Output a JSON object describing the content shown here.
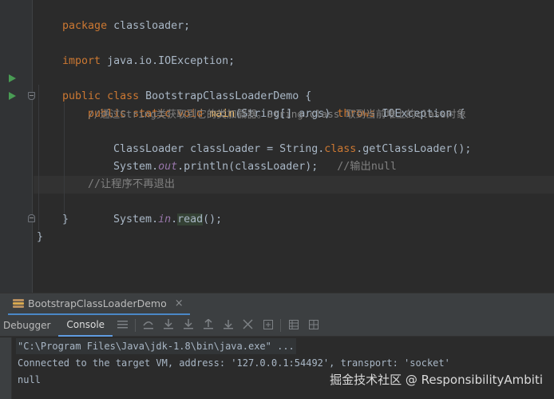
{
  "editor": {
    "lines": {
      "package_kw": "package",
      "package_name": " classloader;",
      "import_kw": "import",
      "import_name": " java.io.IOException;",
      "class_kw1": "public",
      "class_kw2": "class",
      "class_name": " BootstrapClassLoaderDemo {",
      "main_kw1": "public",
      "main_kw2": "static",
      "main_kw3": "void",
      "main_name": "main",
      "main_params": "(String[] args) ",
      "main_throws": "throws",
      "main_exc": " IOException {",
      "comment1": "//通过String类获取到它的类加载器。String.class 取到当前堆上的class对象",
      "cl_type": "ClassLoader classLoader = String.",
      "cl_class_kw": "class",
      "cl_rest": ".getClassLoader();",
      "print_pre": "System.",
      "print_out": "out",
      "print_rest": ".println(classLoader);",
      "comment2": "   //输出null",
      "comment3": "//让程序不再退出",
      "read_pre": "System.",
      "read_in": "in",
      "read_dot": ".",
      "read_name": "read",
      "read_rest": "();",
      "close_method": "}",
      "close_class": "}"
    }
  },
  "run_window": {
    "tab_label": "BootstrapClassLoaderDemo",
    "tab_close": "×",
    "subtabs": {
      "debugger": "Debugger",
      "console": "Console"
    },
    "toolbar_icons": [
      "menu-icon",
      "step-over-icon",
      "step-into-icon",
      "force-step-into-icon",
      "step-out-icon",
      "drop-frame-icon",
      "run-to-cursor-icon",
      "evaluate-icon",
      "table-icon",
      "settings-icon"
    ]
  },
  "console": {
    "command": "\"C:\\Program Files\\Java\\jdk-1.8\\bin\\java.exe\" ...",
    "connected": "Connected to the target VM, address: '127.0.0.1:54492', transport: 'socket'",
    "output": "null"
  },
  "watermark": "掘金技术社区 @ ResponsibilityAmbiti",
  "colors": {
    "keyword": "#cc7832",
    "function": "#ffc66d",
    "comment": "#808080",
    "static_field": "#9876aa",
    "text": "#a9b7c6",
    "background": "#2b2b2b",
    "run_icon": "#499c54"
  }
}
